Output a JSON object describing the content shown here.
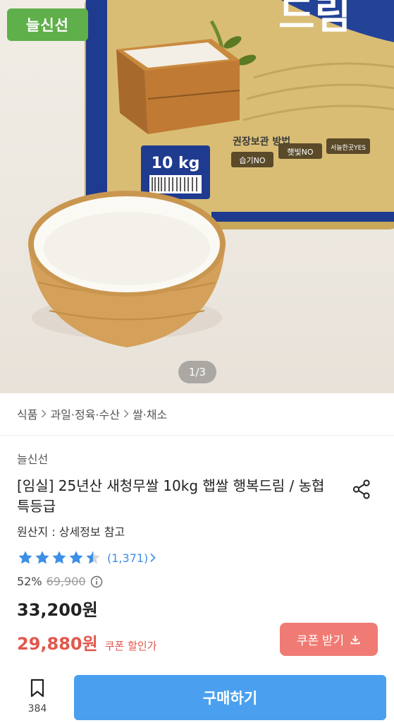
{
  "hero": {
    "badge": "늘신선",
    "counter": "1/3",
    "bag_weight": "10 kg",
    "bag_storage_title": "권장보관 방법",
    "bag_labels": [
      "습기NO",
      "햇빛NO",
      "서늘한곳YES"
    ]
  },
  "breadcrumb": [
    "식품",
    "과일·정육·수산",
    "쌀·채소"
  ],
  "product": {
    "seller": "늘신선",
    "title": "[임실] 25년산 새청무쌀 10kg 햅쌀 행복드림 / 농협 특등급",
    "origin": "원산지 : 상세정보 참고",
    "rating": 4.5,
    "review_count": "(1,371)",
    "discount": "52%",
    "original_price": "69,900",
    "price": "33,200원",
    "coupon_price": "29,880원",
    "coupon_label": "쿠폰 할인가",
    "coupon_button": "쿠폰 받기"
  },
  "bottom": {
    "wish_count": "384",
    "buy_button": "구매하기"
  },
  "colors": {
    "accent_blue": "#4aa0ef",
    "coupon_red": "#e2574c",
    "badge_green": "#5fb04a"
  }
}
